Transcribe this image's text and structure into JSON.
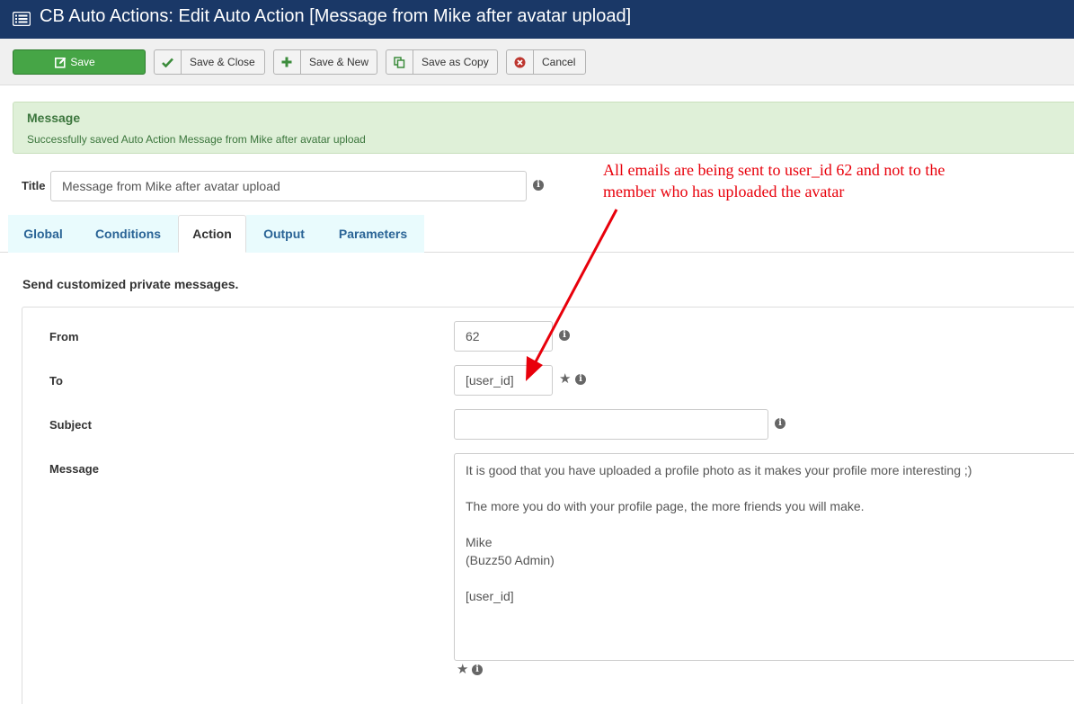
{
  "header": {
    "title": "CB Auto Actions: Edit Auto Action [Message from Mike after avatar upload]",
    "icon": "list-icon"
  },
  "toolbar": {
    "save": "Save",
    "save_close": "Save & Close",
    "save_new": "Save & New",
    "save_copy": "Save as Copy",
    "cancel": "Cancel"
  },
  "alert": {
    "heading": "Message",
    "text": "Successfully saved Auto Action Message from Mike after avatar upload"
  },
  "form": {
    "title_label": "Title",
    "title_value": "Message from Mike after avatar upload"
  },
  "tabs": [
    {
      "label": "Global",
      "active": false
    },
    {
      "label": "Conditions",
      "active": false
    },
    {
      "label": "Action",
      "active": true
    },
    {
      "label": "Output",
      "active": false
    },
    {
      "label": "Parameters",
      "active": false
    }
  ],
  "action": {
    "description": "Send customized private messages.",
    "from_label": "From",
    "from_value": "62",
    "to_label": "To",
    "to_value": "[user_id]",
    "subject_label": "Subject",
    "subject_value": "",
    "message_label": "Message",
    "message_value": "It is good that you have uploaded a profile photo as it makes your profile more interesting ;)\n\nThe more you do with your profile page, the more friends you will make.\n\nMike\n(Buzz50 Admin)\n\n[user_id]"
  },
  "annotation": {
    "text": "All emails are being sent to user_id 62 and not to the\nmember who has uploaded the avatar",
    "color": "#e8000b"
  },
  "colors": {
    "header_bg": "#1a3867",
    "save_green": "#46a546",
    "alert_bg": "#dff0d8",
    "tab_bg": "#e9fbfd"
  }
}
